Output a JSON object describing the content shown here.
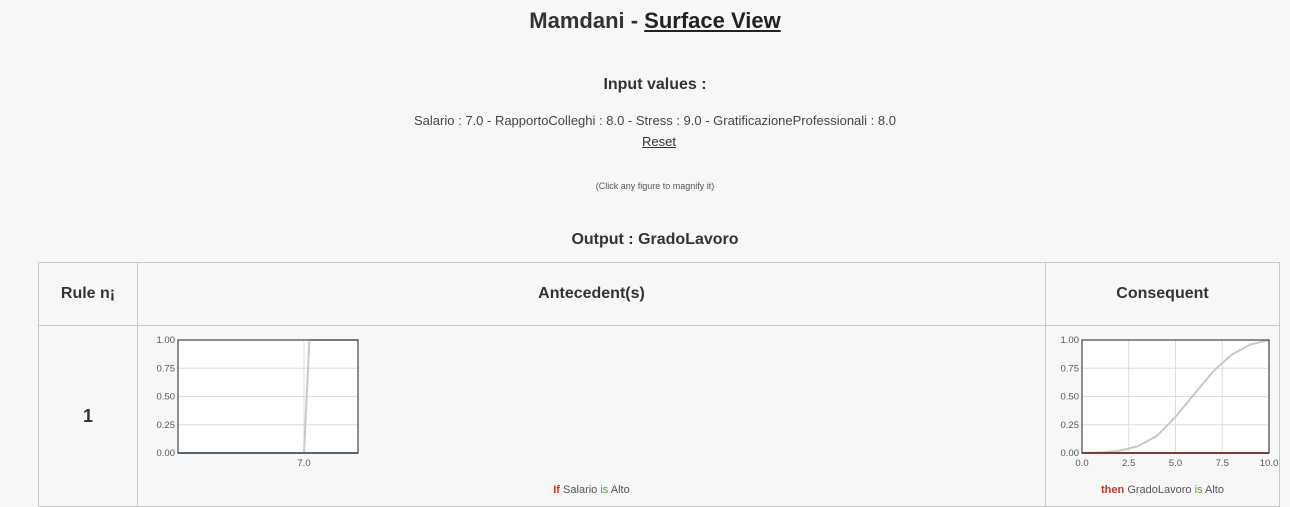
{
  "header": {
    "title_prefix": "Mamdani - ",
    "title_link": "Surface View"
  },
  "inputs": {
    "heading": "Input values :",
    "summary": "Salario : 7.0 - RapportoColleghi : 8.0 - Stress : 9.0 - GratificazioneProfessionali : 8.0",
    "reset_label": "Reset",
    "hint": "(Click any figure to magnify it)"
  },
  "output": {
    "heading": "Output : GradoLavoro"
  },
  "table": {
    "headers": [
      "Rule n¡",
      "Antecedent(s)",
      "Consequent"
    ],
    "rows": [
      {
        "number": "1",
        "antecedent": {
          "if_word": "If",
          "variable": "Salario",
          "is_word": "is",
          "term": "Alto"
        },
        "consequent": {
          "then_word": "then",
          "variable": "GradoLavoro",
          "is_word": "is",
          "term": "Alto"
        }
      }
    ]
  },
  "chart_data": [
    {
      "type": "line",
      "description_of": "antecedent membership plot",
      "yticks": [
        "0.00",
        "0.25",
        "0.50",
        "0.75",
        "1.00"
      ],
      "xticks": [
        "7.0"
      ],
      "ylim": [
        0,
        1
      ],
      "series": [
        {
          "color": "#c8c8c8",
          "x": [
            0,
            7.0,
            7.3,
            10
          ],
          "y": [
            0,
            0,
            1,
            1
          ]
        },
        {
          "color": "#6a9ec8",
          "x": [
            0,
            10
          ],
          "y": [
            0,
            0
          ]
        }
      ]
    },
    {
      "type": "line",
      "description_of": "consequent membership plot",
      "yticks": [
        "0.00",
        "0.25",
        "0.50",
        "0.75",
        "1.00"
      ],
      "xticks": [
        "0.0",
        "2.5",
        "5.0",
        "7.5",
        "10.0"
      ],
      "xlim": [
        0,
        10
      ],
      "ylim": [
        0,
        1
      ],
      "series": [
        {
          "color": "#c8c8c8",
          "x": [
            0,
            1,
            2,
            3,
            4,
            5,
            6,
            7,
            8,
            9,
            10
          ],
          "y": [
            0,
            0.005,
            0.02,
            0.06,
            0.15,
            0.32,
            0.52,
            0.72,
            0.87,
            0.96,
            1.0
          ]
        },
        {
          "color": "#c0392b",
          "x": [
            0,
            10
          ],
          "y": [
            0,
            0
          ]
        }
      ]
    }
  ],
  "colors": {
    "background": "#f7f7f7",
    "keyword": "#c0392b",
    "is_word": "#5a9a2b"
  }
}
